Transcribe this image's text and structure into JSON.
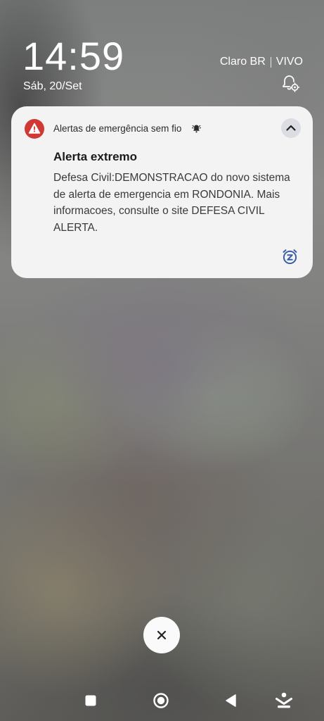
{
  "status": {
    "time": "14:59",
    "date": "Sáb, 20/Set",
    "carrier_1": "Claro BR",
    "carrier_2": "VIVO"
  },
  "notification": {
    "app_name": "Alertas de emergência sem fio",
    "title": "Alerta extremo",
    "body": "Defesa Civil:DEMONSTRACAO do novo sistema de alerta de emergencia em RONDONIA. Mais informacoes, consulte o site DEFESA CIVIL ALERTA.",
    "icon": "warning-triangle-icon",
    "app_icon_color": "#cf3b34"
  },
  "icons": {
    "lock_settings": "gear-icon",
    "bell": "bell-ringing-icon",
    "collapse": "chevron-up-icon",
    "snooze": "snooze-alarm-icon",
    "dismiss": "close-icon",
    "nav_recent": "square-icon",
    "nav_home": "circle-icon",
    "nav_back": "back-triangle-icon",
    "nav_hide": "hide-navbar-icon"
  },
  "colors": {
    "accent": "#3a5fa8",
    "card_background": "#f3f3f4"
  }
}
